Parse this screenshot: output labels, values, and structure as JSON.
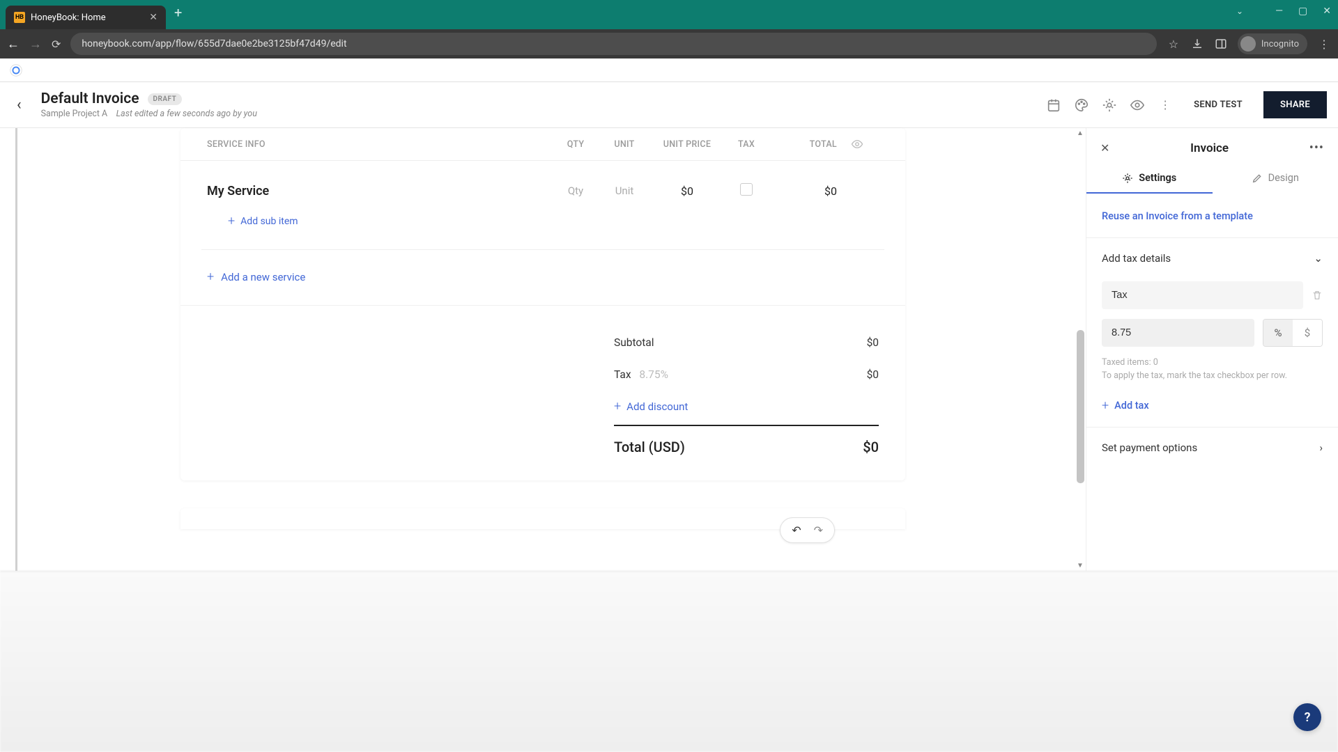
{
  "browser": {
    "tab_title": "HoneyBook: Home",
    "url": "honeybook.com/app/flow/655d7dae0e2be3125bf47d49/edit",
    "incognito_label": "Incognito"
  },
  "header": {
    "title": "Default Invoice",
    "badge": "DRAFT",
    "project": "Sample Project A",
    "edited": "Last edited a few seconds ago by you",
    "send_test": "SEND TEST",
    "share": "SHARE"
  },
  "table": {
    "head": {
      "info": "SERVICE INFO",
      "qty": "QTY",
      "unit": "UNIT",
      "price": "UNIT PRICE",
      "tax": "TAX",
      "total": "TOTAL"
    },
    "row": {
      "name": "My Service",
      "qty": "Qty",
      "unit": "Unit",
      "price": "$0",
      "total": "$0"
    },
    "add_sub": "Add sub item",
    "add_service": "Add a new service"
  },
  "totals": {
    "subtotal_label": "Subtotal",
    "subtotal_value": "$0",
    "tax_label": "Tax",
    "tax_rate": "8.75%",
    "tax_value": "$0",
    "discount": "Add discount",
    "total_label": "Total (USD)",
    "total_value": "$0"
  },
  "panel": {
    "title": "Invoice",
    "tab_settings": "Settings",
    "tab_design": "Design",
    "reuse": "Reuse an Invoice from a template",
    "tax_details": "Add tax details",
    "tax_label": "Tax",
    "tax_value": "8.75",
    "unit_percent": "%",
    "unit_dollar": "$",
    "taxed_items": "Taxed items: 0",
    "tax_hint": "To apply the tax, mark the tax checkbox per row.",
    "add_tax": "Add tax",
    "payment": "Set payment options"
  }
}
